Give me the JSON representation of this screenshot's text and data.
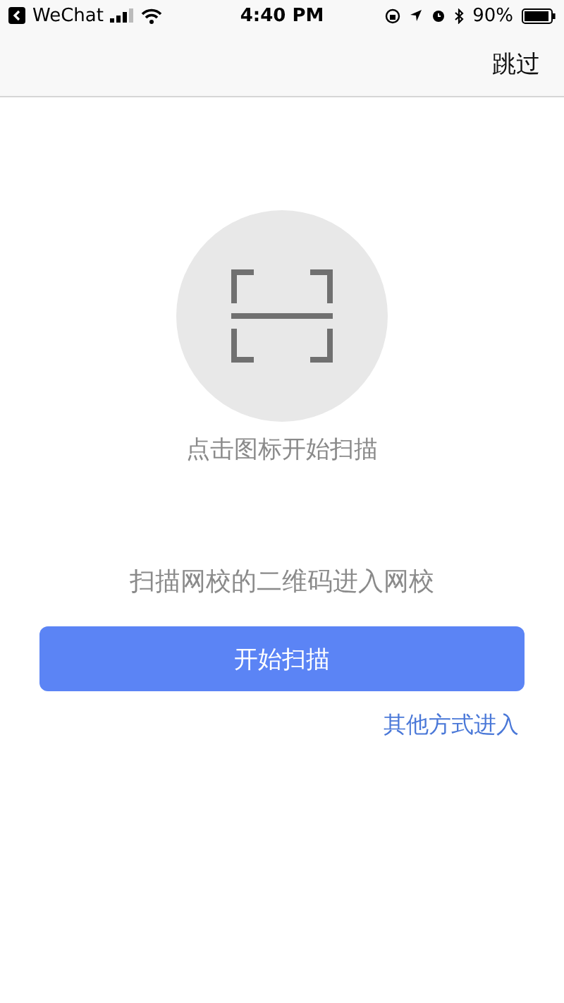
{
  "status_bar": {
    "back_app": "WeChat",
    "time": "4:40 PM",
    "battery": "90%"
  },
  "nav": {
    "action": "跳过"
  },
  "scan": {
    "caption": "点击图标开始扫描"
  },
  "prompt": "扫描网校的二维码进入网校",
  "primary_button": "开始扫描",
  "link": "其他方式进入"
}
